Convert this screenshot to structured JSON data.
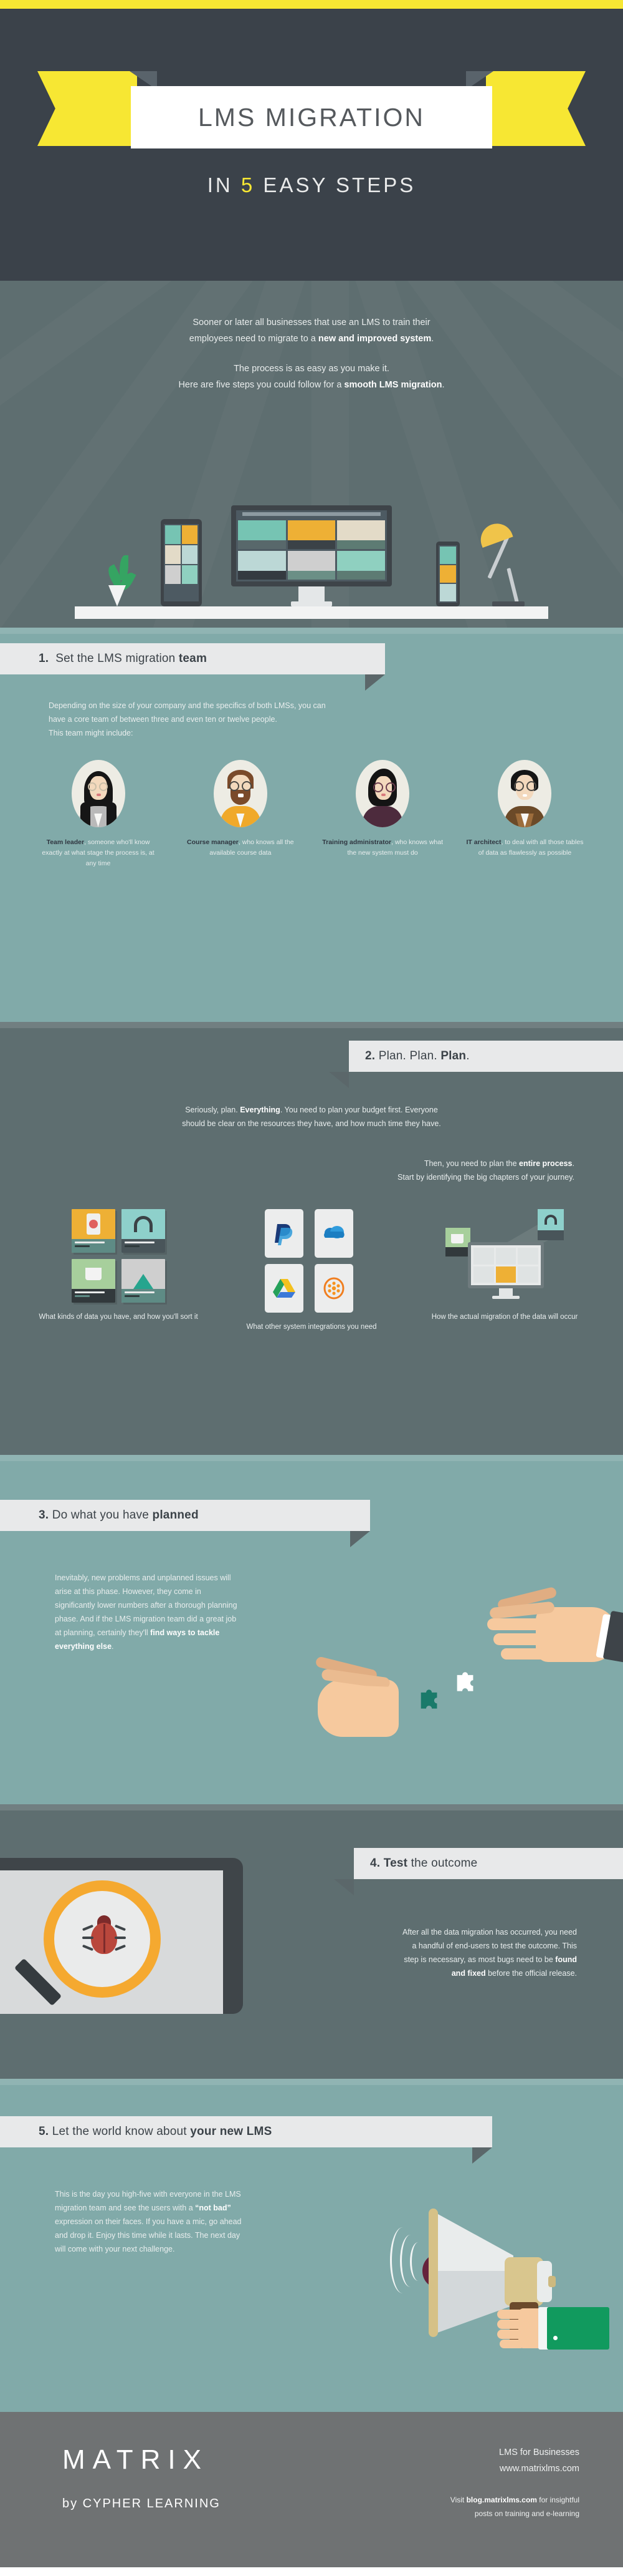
{
  "hero": {
    "title": "LMS MIGRATION",
    "subtitle_pre": "IN ",
    "subtitle_num": "5",
    "subtitle_post": " EASY STEPS",
    "accent_yellow": "#f7e733",
    "bg": "#3b424a"
  },
  "intro": {
    "p1_a": "Sooner or later all businesses that use an LMS to train their",
    "p1_b": "employees need to migrate to a ",
    "p1_bold": "new and improved system",
    "p1_c": ".",
    "p2_a": "The process is as easy as you make it.",
    "p2_b": "Here are five steps you could follow for a ",
    "p2_bold": "smooth LMS migration",
    "p2_c": "."
  },
  "steps": [
    {
      "number": "1.",
      "title_plain": "Set the LMS migration ",
      "title_bold": "team",
      "body_lines": [
        "Depending on the size of your company and the specifics of both LMSs, you can",
        "have a core team of between three and even ten or twelve people.",
        "This team might include:"
      ],
      "roles": [
        {
          "name": "Team leader",
          "rest": ", someone who'll know exactly at what stage the process is, at any time"
        },
        {
          "name": "Course manager",
          "rest": ",  who knows all the available course data"
        },
        {
          "name": "Training administrator",
          "rest": ", who knows what the new system must do"
        },
        {
          "name": "IT architect",
          "rest": ", to deal with all those tables of data as flawlessly as possible"
        }
      ]
    },
    {
      "number": "2.",
      "title_plain": "Plan. Plan. ",
      "title_bold": "Plan",
      "title_tail": ".",
      "body_a1": "Seriously, plan. ",
      "body_a_bold": "Everything",
      "body_a2": ". You need to plan your budget first. Everyone",
      "body_a3": "should be clear on the resources they have, and how much time they have.",
      "body_b1": "Then, you need to plan the ",
      "body_b_bold": "entire process",
      "body_b2": ".",
      "body_b3": "Start by identifying the big chapters of your journey.",
      "captions": [
        "What kinds of data you have, and how you'll sort it",
        "What other system integrations you need",
        "How the actual migration of the data will occur"
      ],
      "integration_icons": [
        "paypal-icon",
        "onedrive-cloud-icon",
        "google-drive-icon",
        "flower-app-icon"
      ]
    },
    {
      "number": "3.",
      "title_plain": "Do what you have ",
      "title_bold": "planned",
      "body_1": "Inevitably, new problems and unplanned issues will arise at this phase. However, they come in significantly lower numbers after a thorough planning phase. And if the LMS migration team did a great job at planning, certainly they'll ",
      "body_bold": "find ways to tackle everything else",
      "body_2": "."
    },
    {
      "number": "4.",
      "title_bold": "Test",
      "title_plain": " the outcome",
      "body_1": "After all the data migration has occurred, you need a handful of end-users to test the outcome. This step is necessary, as most bugs need to be ",
      "body_bold": "found and fixed",
      "body_2": " before the official release."
    },
    {
      "number": "5.",
      "title_plain": "Let the world know about ",
      "title_bold": "your new LMS",
      "body_1": "This is the day you high-five with everyone in the LMS migration team and see the users with a ",
      "body_bold": "“not bad”",
      "body_2": " expression on their faces. If you have a mic, go ahead and drop it. Enjoy this time while it lasts. The next day will come with your next challenge."
    }
  ],
  "footer": {
    "logo": "MATRIX",
    "tagline": "by CYPHER LEARNING",
    "line1": "LMS for Businesses",
    "line2": "www.matrixlms.com",
    "cta_pre": "Visit ",
    "cta_link": "blog.matrixlms.com",
    "cta_post": " for insightful",
    "cta_line2": "posts on training and e-learning"
  }
}
